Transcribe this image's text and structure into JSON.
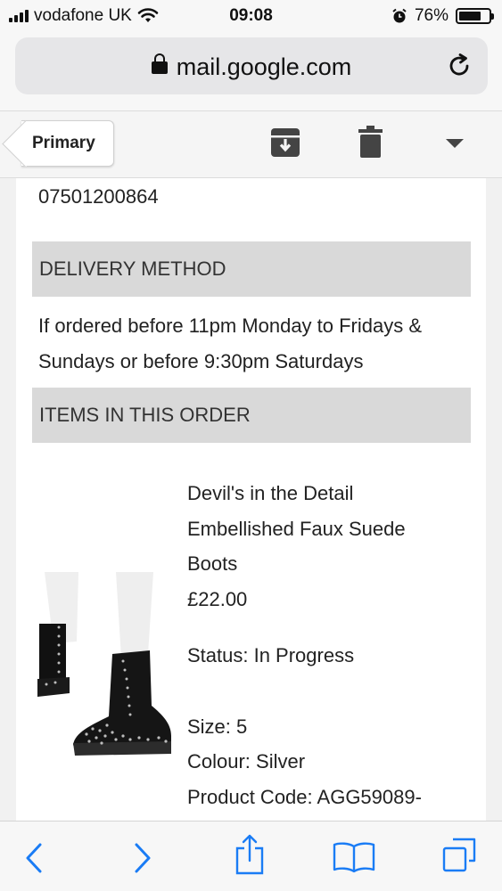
{
  "status_bar": {
    "carrier": "vodafone UK",
    "time": "09:08",
    "battery_percent": "76%",
    "battery_level": 0.76
  },
  "browser": {
    "url": "mail.google.com"
  },
  "gmail_toolbar": {
    "back_label": "Primary",
    "icons": [
      "archive-icon",
      "trash-icon",
      "dropdown-caret-icon"
    ]
  },
  "email": {
    "phone": "07501200864",
    "delivery_heading": "DELIVERY METHOD",
    "delivery_text": "If ordered before 11pm Monday to Fridays & Sundays or before 9:30pm Saturdays",
    "items_heading": "ITEMS IN THIS ORDER",
    "item": {
      "name_line1": "Devil's in the Detail",
      "name_line2": "Embellished Faux Suede",
      "name_line3": "Boots",
      "price": "£22.00",
      "status": "Status: In Progress",
      "size": "Size: 5",
      "colour": "Colour: Silver",
      "product_code": "Product Code: AGG59089-"
    }
  },
  "bottom_toolbar": {
    "icons": [
      "back-icon",
      "forward-icon",
      "share-icon",
      "bookmarks-icon",
      "tabs-icon"
    ]
  },
  "colors": {
    "ios_blue": "#1a7cf5",
    "section_header_bg": "#d9d9d9",
    "toolbar_icon": "#444444"
  }
}
